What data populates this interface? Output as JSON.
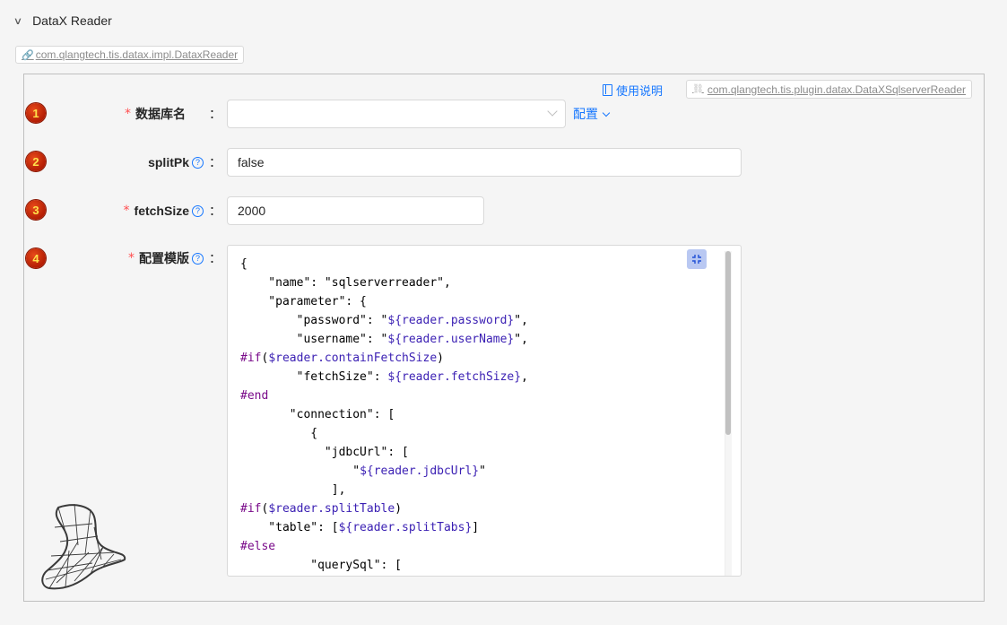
{
  "section": {
    "title": "DataX Reader"
  },
  "impl_tag": {
    "label": "com.qlangtech.tis.datax.impl.DataxReader"
  },
  "header": {
    "doc_link": "使用说明",
    "plugin_tag": "com.qlangtech.tis.plugin.datax.DataXSqlserverReader"
  },
  "fields": [
    {
      "index": "1",
      "label": "数据库名",
      "required": "*",
      "value": "",
      "config_link": "配置"
    },
    {
      "index": "2",
      "label": "splitPk",
      "required": "",
      "value": "false"
    },
    {
      "index": "3",
      "label": "fetchSize",
      "required": "*",
      "value": "2000"
    },
    {
      "index": "4",
      "label": "配置模版",
      "required": "*"
    }
  ],
  "colon": "：",
  "help_icon": "?",
  "editor": {
    "lines": [
      "{",
      "    \"name\": \"sqlserverreader\",",
      "    \"parameter\": {",
      "        \"password\": \"${reader.password}\",",
      "        \"username\": \"${reader.userName}\",",
      "#if($reader.containFetchSize)",
      "        \"fetchSize\": ${reader.fetchSize},",
      "#end",
      "       \"connection\": [",
      "          {",
      "            \"jdbcUrl\": [",
      "                \"${reader.jdbcUrl}\"",
      "             ],",
      "#if($reader.splitTable)",
      "    \"table\": [${reader.splitTabs}]",
      "#else",
      "          \"querySql\": ["
    ]
  },
  "icons": {
    "collapse": "chevron-down-icon",
    "link": "link-icon",
    "doc": "file-icon",
    "fullscreen": "fullscreen-exit-icon",
    "help": "question-circle-icon",
    "logo": "sqlserver-logo"
  }
}
